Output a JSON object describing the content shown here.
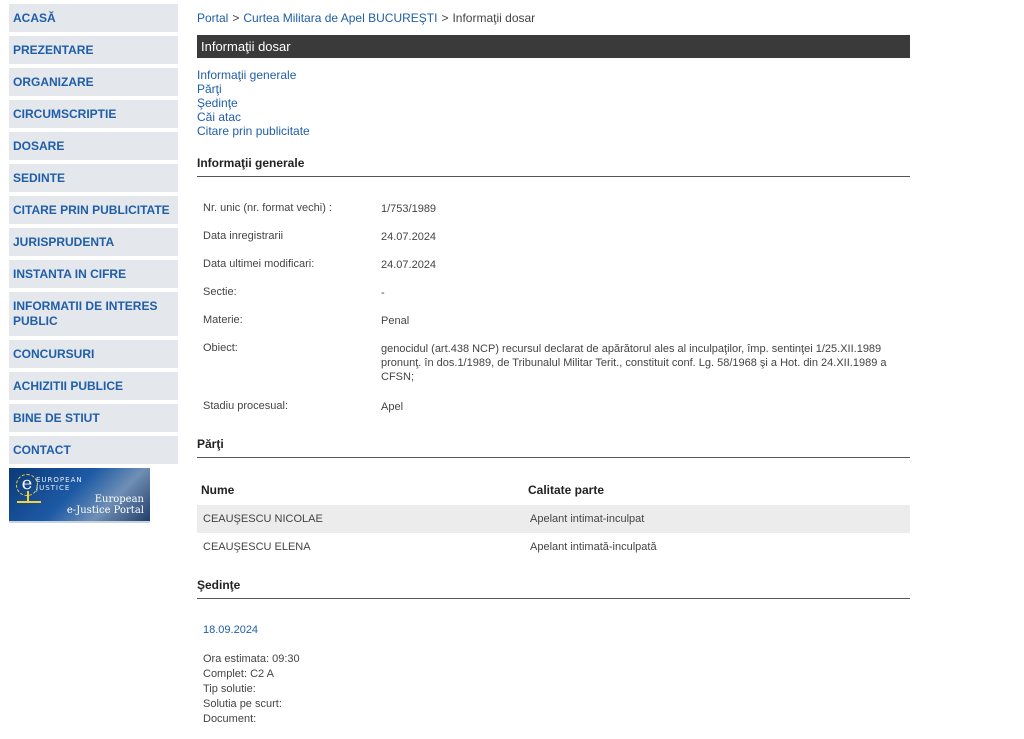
{
  "sidebar": {
    "items": [
      {
        "label": "ACASĂ"
      },
      {
        "label": "PREZENTARE"
      },
      {
        "label": "ORGANIZARE"
      },
      {
        "label": "CIRCUMSCRIPTIE"
      },
      {
        "label": "DOSARE"
      },
      {
        "label": "SEDINTE"
      },
      {
        "label": "CITARE PRIN PUBLICITATE"
      },
      {
        "label": "JURISPRUDENTA"
      },
      {
        "label": "INSTANTA IN CIFRE"
      },
      {
        "label": "INFORMATII DE INTERES PUBLIC"
      },
      {
        "label": "CONCURSURI"
      },
      {
        "label": "ACHIZITII PUBLICE"
      },
      {
        "label": "BINE DE STIUT"
      },
      {
        "label": "CONTACT"
      }
    ],
    "banner": {
      "circle_letter": "e",
      "small_line1": "EUROPEAN",
      "small_line2": "JUSTICE",
      "title_line1": "European",
      "title_line2": "e-Justice Portal"
    }
  },
  "breadcrumb": {
    "portal": "Portal",
    "sep": ">",
    "court": "Curtea Militara de Apel BUCUREŞTI",
    "current": "Informaţii dosar"
  },
  "title_bar": "Informaţii dosar",
  "toc": [
    "Informaţii generale",
    "Părţi",
    "Şedinţe",
    "Căi atac",
    "Citare prin publicitate"
  ],
  "general": {
    "heading": "Informaţii generale",
    "rows": [
      {
        "label": "Nr. unic (nr. format vechi) :",
        "value": "1/753/1989"
      },
      {
        "label": "Data inregistrarii",
        "value": "24.07.2024"
      },
      {
        "label": "Data ultimei modificari:",
        "value": "24.07.2024"
      },
      {
        "label": "Sectie:",
        "value": "-"
      },
      {
        "label": "Materie:",
        "value": "Penal"
      },
      {
        "label": "Obiect:",
        "value": "genocidul (art.438 NCP) recursul declarat de apărătorul ales al inculpaţilor, împ. sentinţei 1/25.XII.1989 pronunţ. în dos.1/1989, de Tribunalul Militar Terit., constituit conf. Lg. 58/1968 şi a Hot. din 24.XII.1989 a CFSN;"
      },
      {
        "label": "Stadiu procesual:",
        "value": "Apel"
      }
    ]
  },
  "parti": {
    "heading": "Părţi",
    "col_name": "Nume",
    "col_role": "Calitate parte",
    "rows": [
      {
        "name": "CEAUŞESCU NICOLAE",
        "role": "Apelant intimat-inculpat"
      },
      {
        "name": "CEAUŞESCU ELENA",
        "role": "Apelant intimată-inculpată"
      }
    ]
  },
  "sedinte": {
    "heading": "Şedinţe",
    "date": "18.09.2024",
    "details": [
      "Ora estimata: 09:30",
      "Complet: C2 A",
      "Tip solutie:",
      "Solutia pe scurt:",
      "Document:"
    ]
  }
}
